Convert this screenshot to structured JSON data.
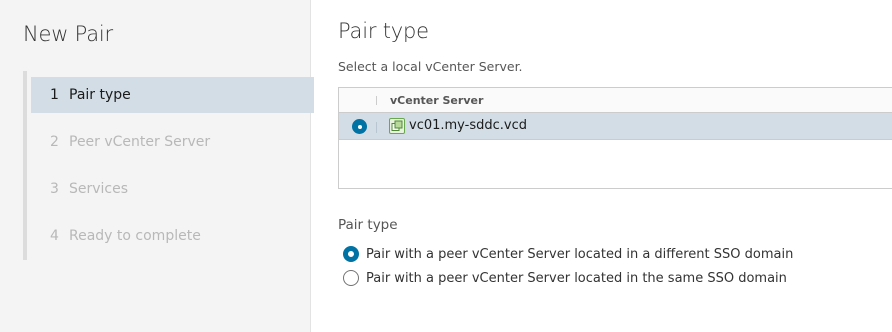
{
  "wizard": {
    "title": "New Pair",
    "steps": [
      {
        "num": "1",
        "label": "Pair type",
        "state": "active"
      },
      {
        "num": "2",
        "label": "Peer vCenter Server",
        "state": "disabled"
      },
      {
        "num": "3",
        "label": "Services",
        "state": "disabled"
      },
      {
        "num": "4",
        "label": "Ready to complete",
        "state": "disabled"
      }
    ]
  },
  "page": {
    "title": "Pair type",
    "subtitle": "Select a local vCenter Server."
  },
  "grid": {
    "columns": [
      "vCenter Server"
    ],
    "rows": [
      {
        "name": "vc01.my-sddc.vcd",
        "selected": true,
        "icon": "vcenter-server-icon"
      }
    ]
  },
  "pair_type": {
    "label": "Pair type",
    "options": [
      {
        "label": "Pair with a peer vCenter Server located in a different SSO domain",
        "checked": true
      },
      {
        "label": "Pair with a peer vCenter Server located in the same SSO domain",
        "checked": false
      }
    ]
  },
  "colors": {
    "accent": "#0072a3",
    "selected_row": "#d3dde6",
    "sidebar_bg": "#f4f4f4",
    "icon_green": "#6aa84f"
  }
}
